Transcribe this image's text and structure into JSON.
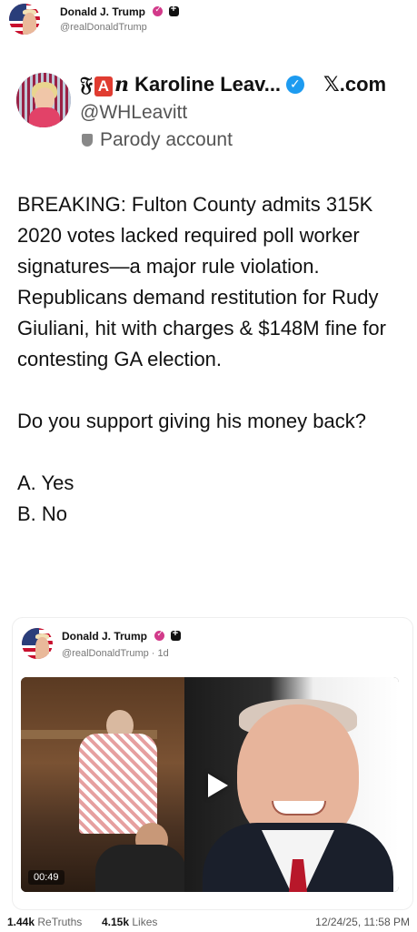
{
  "post": {
    "author_name": "Donald J. Trump",
    "author_handle": "@realDonaldTrump"
  },
  "embed": {
    "name_prefix": "𝔉",
    "name_a": "A",
    "name_n": "n",
    "display_name": "Karoline Leav...",
    "source": "𝕏.com",
    "handle": "@WHLeavitt",
    "parody_label": "Parody account"
  },
  "body": {
    "paragraph1": "BREAKING: Fulton County admits 315K 2020 votes lacked required poll worker signatures—a major rule violation. Republicans demand restitution for Rudy Giuliani, hit with charges & $148M fine for contesting GA election.",
    "paragraph2": "Do you support giving his money back?",
    "option_a": "A. Yes",
    "option_b": "B. No"
  },
  "quoted": {
    "author_name": "Donald J. Trump",
    "handle_time": "@realDonaldTrump · 1d",
    "video_duration": "00:49"
  },
  "footer": {
    "retruths_count": "1.44k",
    "retruths_label": "ReTruths",
    "likes_count": "4.15k",
    "likes_label": "Likes",
    "timestamp": "12/24/25, 11:58 PM"
  }
}
